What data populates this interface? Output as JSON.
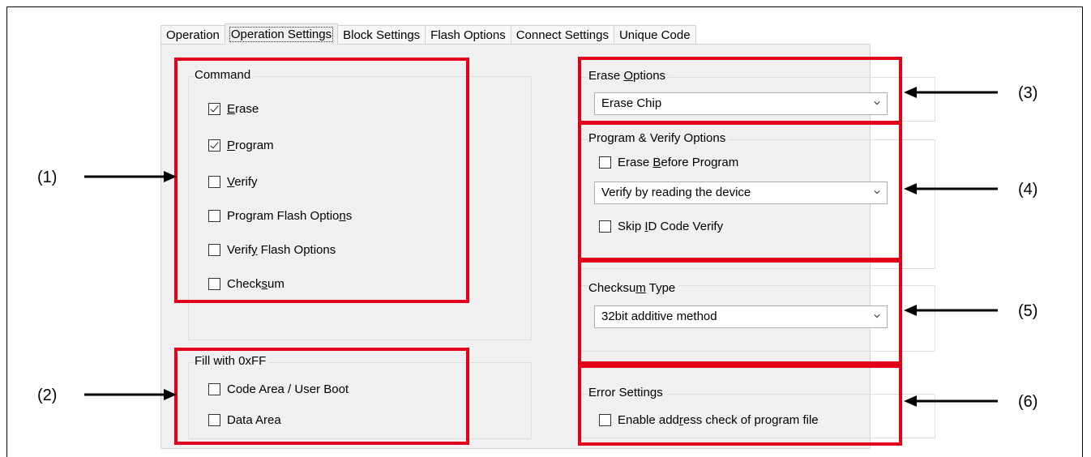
{
  "tabs": [
    {
      "label": "Operation"
    },
    {
      "label": "Operation Settings",
      "active": true
    },
    {
      "label": "Block Settings"
    },
    {
      "label": "Flash Options"
    },
    {
      "label": "Connect Settings"
    },
    {
      "label": "Unique Code"
    }
  ],
  "command": {
    "title": "Command",
    "items": [
      {
        "pre": "",
        "mn": "E",
        "post": "rase",
        "checked": true
      },
      {
        "pre": "",
        "mn": "P",
        "post": "rogram",
        "checked": true
      },
      {
        "pre": "",
        "mn": "V",
        "post": "erify",
        "checked": false
      },
      {
        "pre": "Program Flash Optio",
        "mn": "n",
        "post": "s",
        "checked": false
      },
      {
        "pre": "Verif",
        "mn": "y",
        "post": " Flash Options",
        "checked": false
      },
      {
        "pre": "Check",
        "mn": "s",
        "post": "um",
        "checked": false
      }
    ]
  },
  "fill": {
    "title": "Fill with 0xFF",
    "items": [
      {
        "label": "Code Area / User Boot",
        "checked": false
      },
      {
        "label": "Data Area",
        "checked": false
      }
    ]
  },
  "erase_options": {
    "title_pre": "Erase ",
    "title_mn": "O",
    "title_post": "ptions",
    "value": "Erase Chip"
  },
  "program_verify": {
    "title": "Program & Verify Options",
    "erase_before": {
      "pre": "Erase ",
      "mn": "B",
      "post": "efore Program",
      "checked": false
    },
    "verify_value": "Verify by reading the device",
    "skip_id": {
      "pre": "Skip ",
      "mn": "I",
      "post": "D Code Verify",
      "checked": false
    }
  },
  "checksum_type": {
    "title_pre": "Checksu",
    "title_mn": "m",
    "title_post": " Type",
    "value": "32bit additive method"
  },
  "error_settings": {
    "title": "Error Settings",
    "item": {
      "pre": "Enable add",
      "mn": "r",
      "post": "ess check of program file",
      "checked": false
    }
  },
  "callouts": {
    "c1": "(1)",
    "c2": "(2)",
    "c3": "(3)",
    "c4": "(4)",
    "c5": "(5)",
    "c6": "(6)"
  },
  "colors": {
    "highlight": "#e3001b",
    "panel_bg": "#f0f0f0"
  }
}
